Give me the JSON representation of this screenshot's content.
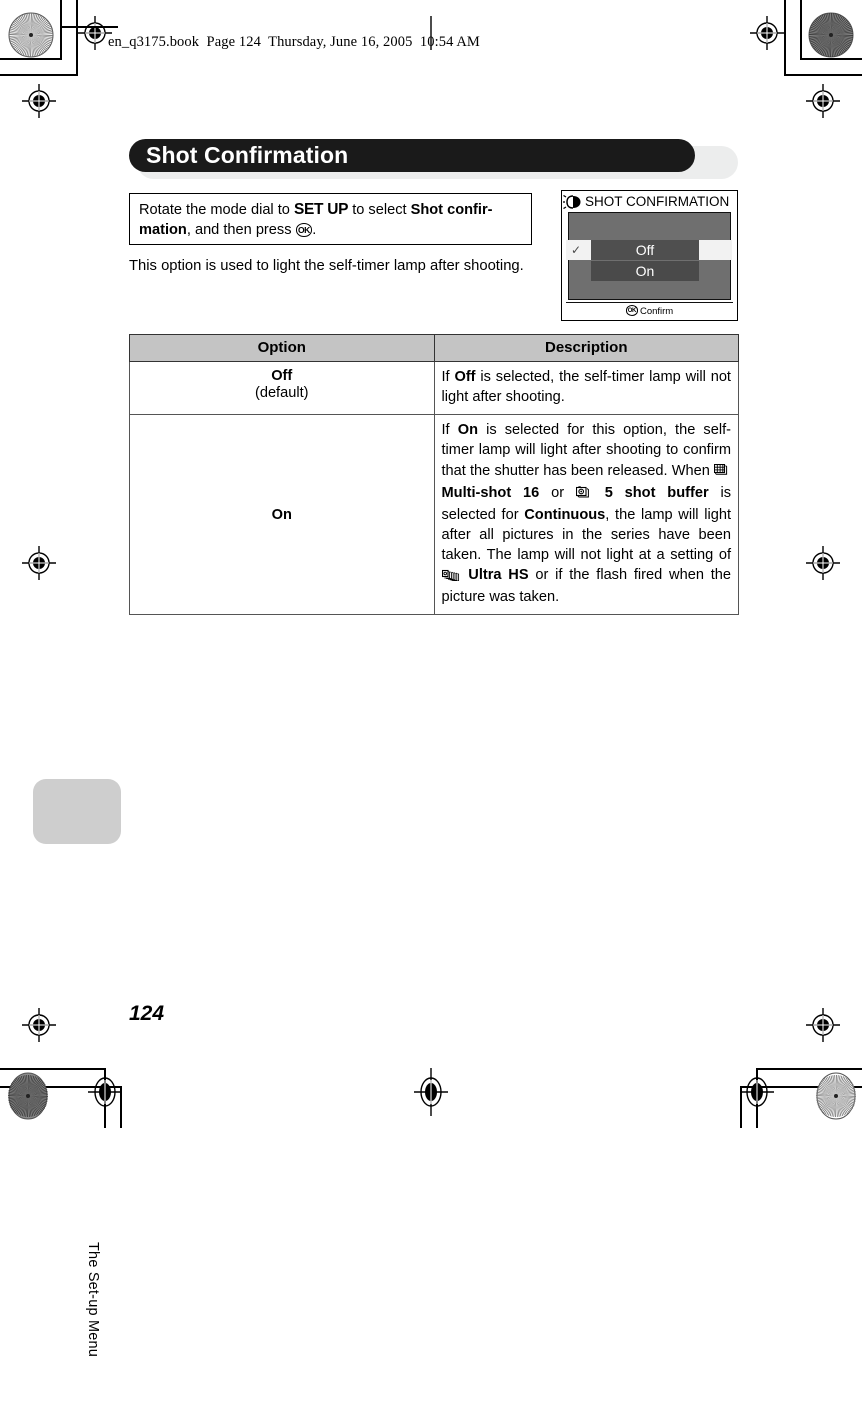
{
  "header": {
    "text": "en_q3175.book  Page 124  Thursday, June 16, 2005  10:54 AM"
  },
  "section": {
    "title": "Shot Confirmation",
    "running_head": "The Set-up Menu",
    "page_number": "124"
  },
  "instruction": {
    "prefix": "Rotate the mode dial to ",
    "dial_label": "SET UP",
    "middle": " to select ",
    "menu_item": "Shot confir-mation",
    "suffix": ", and then press ",
    "ok_glyph": "OK",
    "period": "."
  },
  "intro_paragraph": "This option is used to light the self-timer lamp after shooting.",
  "lcd": {
    "title": "SHOT CONFIRMATION",
    "lamp_icon": "self-timer-lamp-icon",
    "checkmark": "✓",
    "options": [
      {
        "label": "Off",
        "selected": true
      },
      {
        "label": "On",
        "selected": false
      }
    ],
    "footer_button": "OK",
    "footer_label": "Confirm"
  },
  "table": {
    "headers": [
      "Option",
      "Description"
    ],
    "rows": [
      {
        "option_name": "Off",
        "option_sub": "(default)",
        "description_parts": [
          {
            "t": "If ",
            "b": false
          },
          {
            "t": "Off",
            "b": true
          },
          {
            "t": " is selected, the self-timer lamp will not light after shooting.",
            "b": false
          }
        ]
      },
      {
        "option_name": "On",
        "option_sub": "",
        "description_parts": [
          {
            "t": "If ",
            "b": false
          },
          {
            "t": "On",
            "b": true
          },
          {
            "t": " is selected for this option, the self-timer lamp will light after shooting to confirm that the shutter has been released. When ",
            "b": false
          },
          {
            "icon": "multi-shot-grid-icon"
          },
          {
            "t": " Multi-shot 16",
            "b": true
          },
          {
            "t": " or ",
            "b": false
          },
          {
            "icon": "five-shot-buffer-icon"
          },
          {
            "t": " 5 shot buffer",
            "b": true
          },
          {
            "t": " is selected for ",
            "b": false
          },
          {
            "t": "Continuous",
            "b": true
          },
          {
            "t": ", the lamp will light after all pictures in the series have been taken. The lamp will not light at a setting of ",
            "b": false
          },
          {
            "icon": "ultra-hs-stack-icon"
          },
          {
            "t": " Ultra HS",
            "b": true
          },
          {
            "t": " or if the flash fired when the picture was taken.",
            "b": false
          }
        ]
      }
    ]
  },
  "colors": {
    "banner": "#1a1a1a",
    "banner_shadow": "#eceded",
    "table_header": "#c4c4c4",
    "lcd_background": "#6f6f6f",
    "side_tab": "#cecece"
  }
}
